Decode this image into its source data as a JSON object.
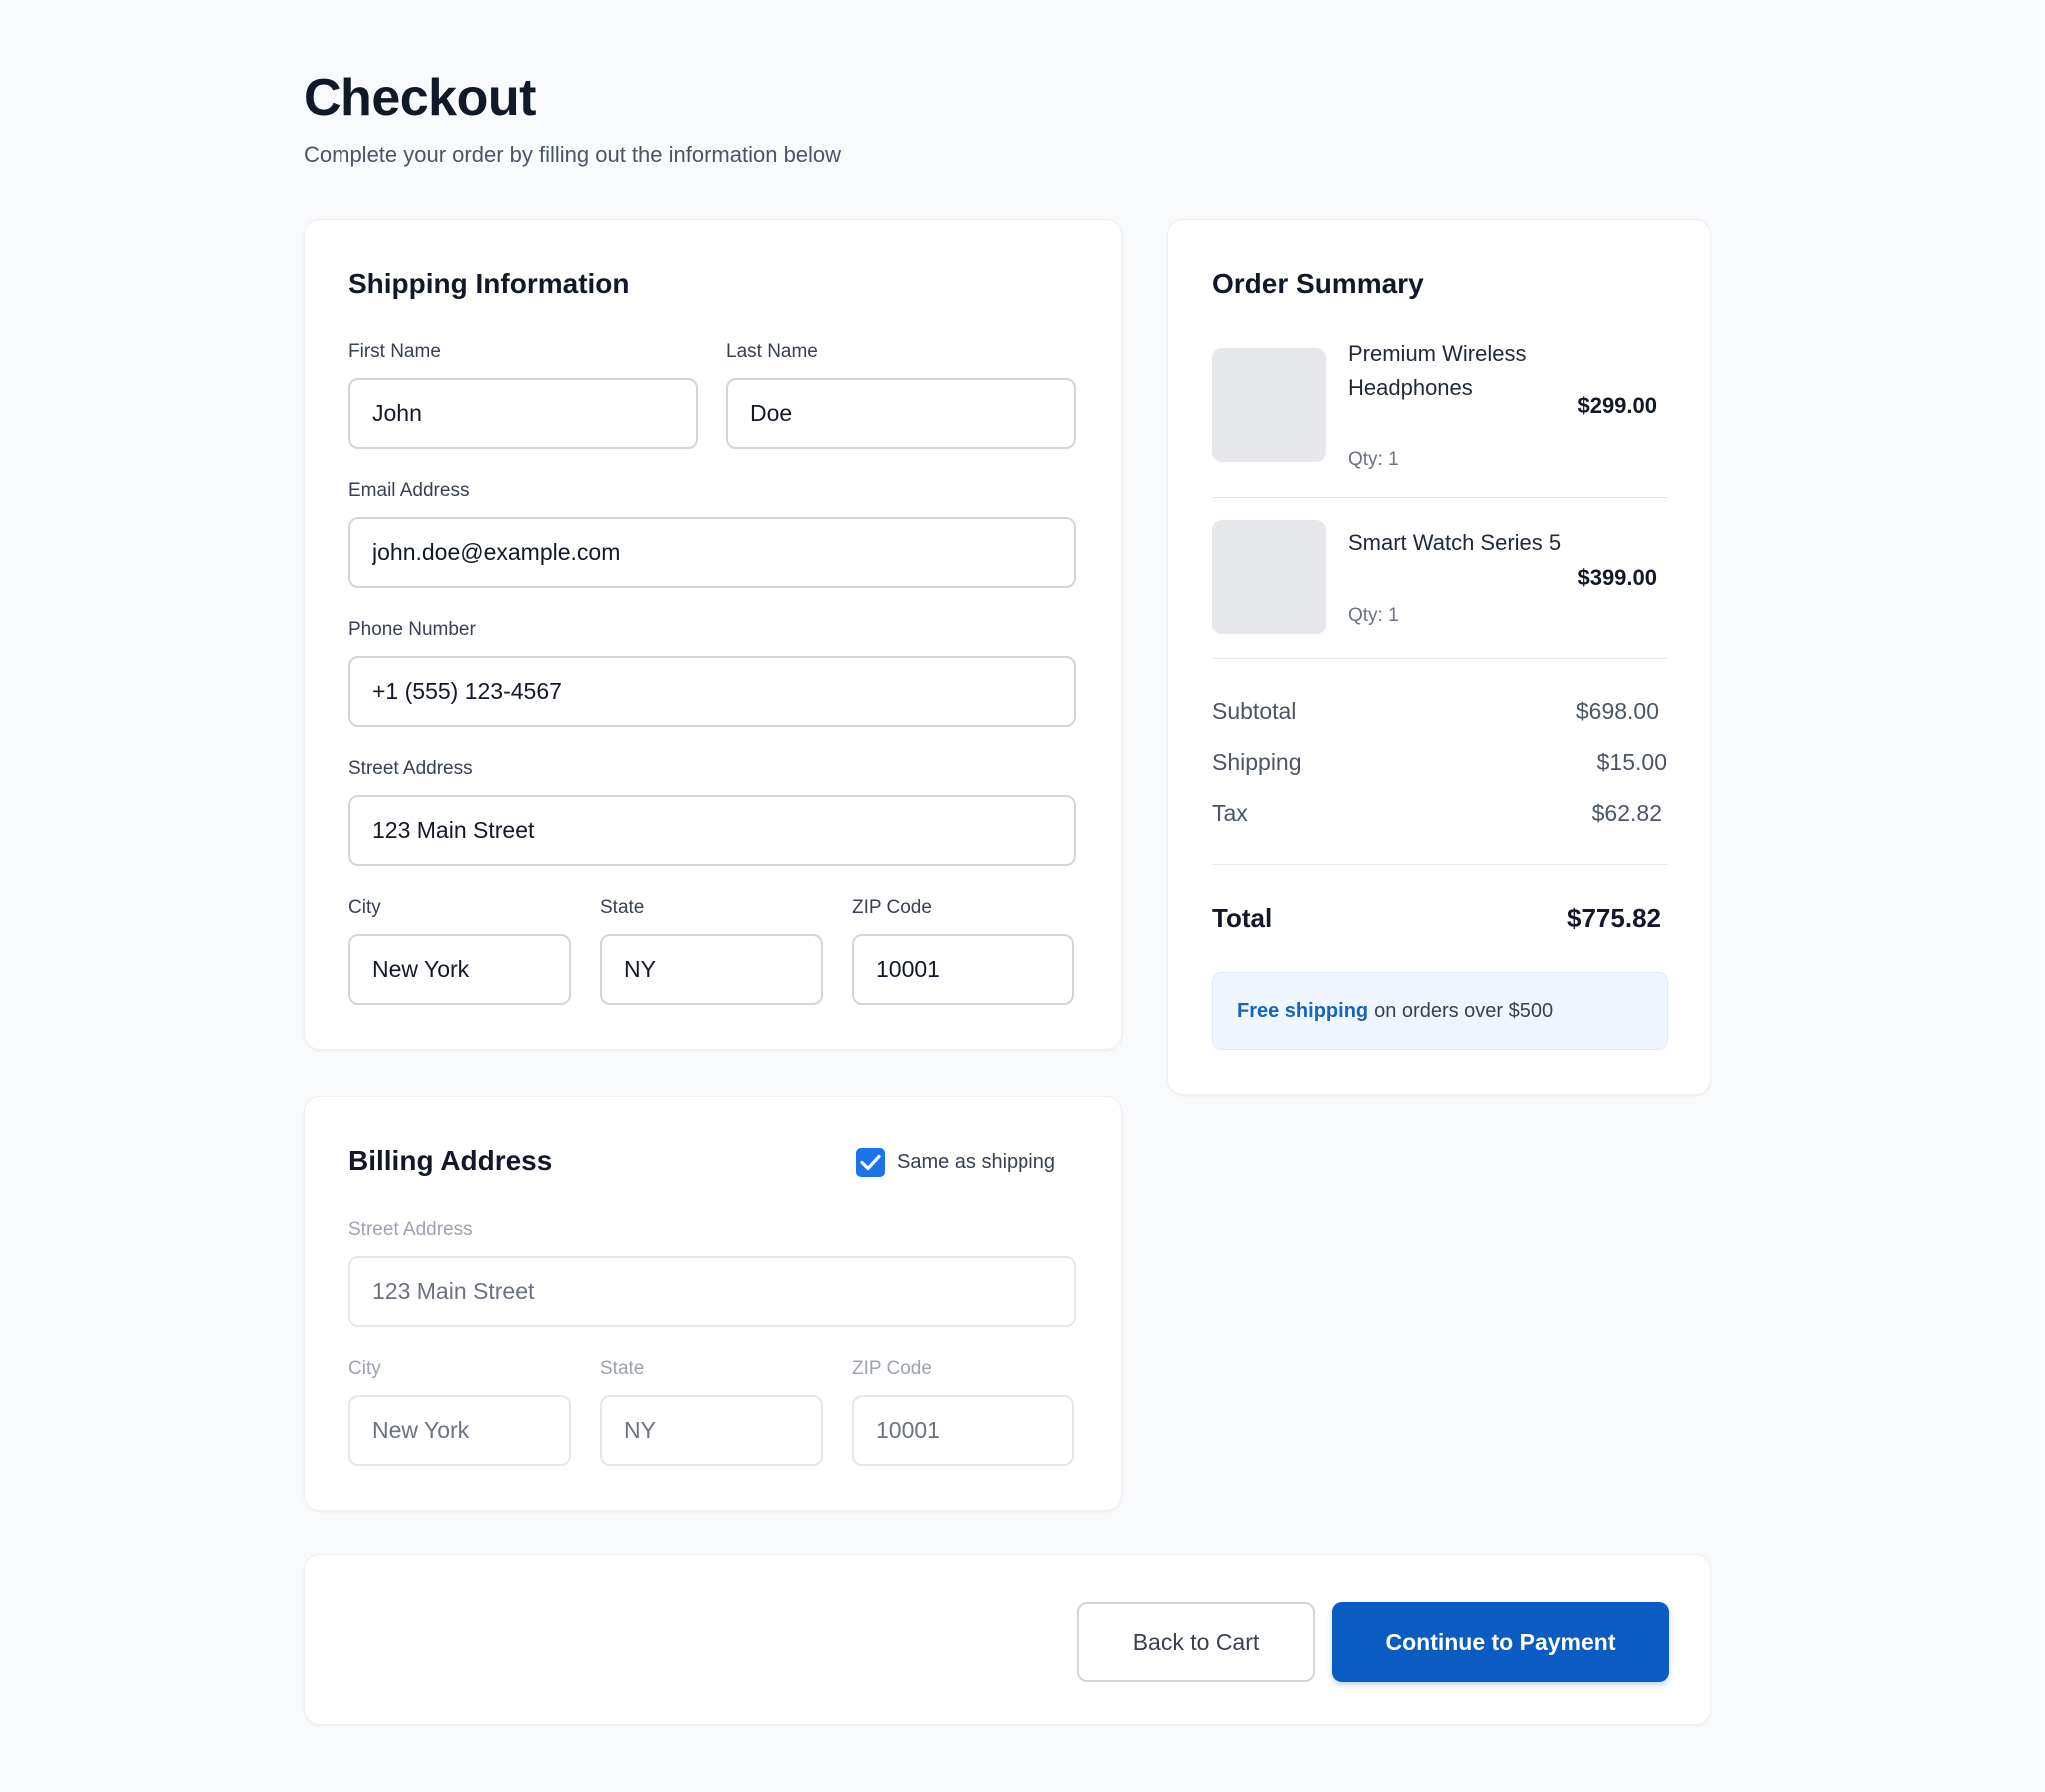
{
  "header": {
    "title": "Checkout",
    "subtitle": "Complete your order by filling out the information below"
  },
  "shipping": {
    "title": "Shipping Information",
    "first_name": {
      "label": "First Name",
      "value": "John"
    },
    "last_name": {
      "label": "Last Name",
      "value": "Doe"
    },
    "email": {
      "label": "Email Address",
      "value": "john.doe@example.com"
    },
    "phone": {
      "label": "Phone Number",
      "value": "+1 (555) 123-4567"
    },
    "street": {
      "label": "Street Address",
      "value": "123 Main Street"
    },
    "city": {
      "label": "City",
      "value": "New York"
    },
    "state": {
      "label": "State",
      "value": "NY"
    },
    "zip": {
      "label": "ZIP Code",
      "value": "10001"
    }
  },
  "billing": {
    "title": "Billing Address",
    "same_as_shipping": {
      "label": "Same as shipping",
      "checked": true
    },
    "street": {
      "label": "Street Address",
      "value": "123 Main Street"
    },
    "city": {
      "label": "City",
      "value": "New York"
    },
    "state": {
      "label": "State",
      "value": "NY"
    },
    "zip": {
      "label": "ZIP Code",
      "value": "10001"
    }
  },
  "summary": {
    "title": "Order Summary",
    "items": [
      {
        "name": "Premium Wireless Headphones",
        "qty": "Qty: 1",
        "price": "$299.00"
      },
      {
        "name": "Smart Watch Series 5",
        "qty": "Qty: 1",
        "price": "$399.00"
      }
    ],
    "subtotal": {
      "label": "Subtotal",
      "value": "$698.00"
    },
    "shipping": {
      "label": "Shipping",
      "value": "$15.00"
    },
    "tax": {
      "label": "Tax",
      "value": "$62.82"
    },
    "total": {
      "label": "Total",
      "value": "$775.82"
    },
    "promo": {
      "strong": "Free shipping",
      "text": "on orders over $500"
    }
  },
  "actions": {
    "back_label": "Back to Cart",
    "continue_label": "Continue to Payment"
  },
  "colors": {
    "primary": "#0b5cc2",
    "checkbox": "#1a73e8",
    "promo_bg": "#eff6ff",
    "promo_accent": "#1565c0",
    "page_bg": "#f8fafc"
  }
}
